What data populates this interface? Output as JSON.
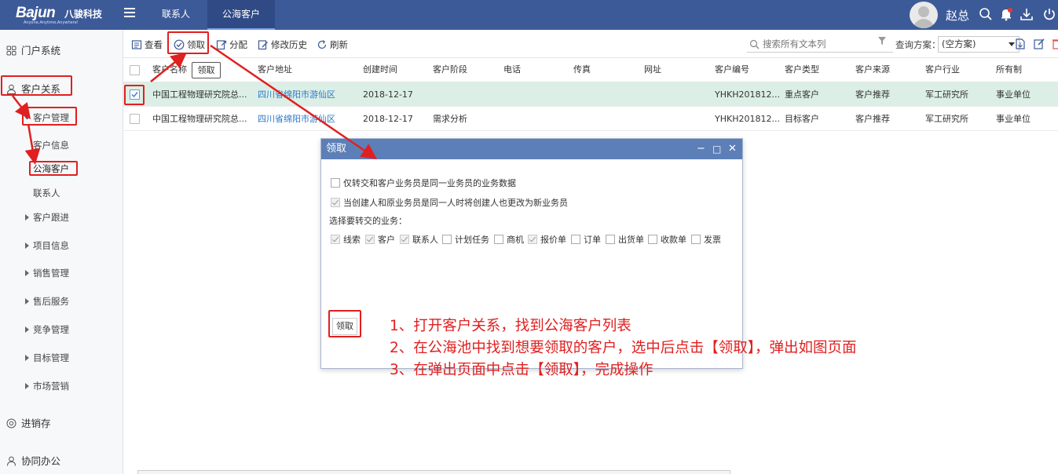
{
  "topbar": {
    "logo_brand": "Bajun",
    "logo_cn": "八骏科技",
    "logo_slogan": "Anyone,Anytime,Anywhere!",
    "tabs": [
      {
        "label": "联系人"
      },
      {
        "label": "公海客户"
      }
    ],
    "username": "赵总"
  },
  "sidebar": {
    "portal": "门户系统",
    "crm": "客户关系",
    "customer_mgmt": "客户管理",
    "customer_info": "客户信息",
    "public_customers": "公海客户",
    "contacts": "联系人",
    "groups": [
      "客户跟进",
      "项目信息",
      "销售管理",
      "售后服务",
      "竞争管理",
      "目标管理",
      "市场营销"
    ],
    "inventory": "进销存",
    "collab": "协同办公"
  },
  "toolbar": {
    "view": "查看",
    "claim": "领取",
    "assign": "分配",
    "history": "修改历史",
    "refresh": "刷新",
    "search_placeholder": "搜索所有文本列",
    "plan_label": "查询方案：",
    "plan_value": "(空方案)"
  },
  "grid": {
    "columns": [
      "客户名称",
      "客户地址",
      "创建时间",
      "客户阶段",
      "电话",
      "传真",
      "网址",
      "客户编号",
      "客户类型",
      "客户来源",
      "客户行业",
      "所有制"
    ],
    "claim_tooltip": "领取",
    "rows": [
      {
        "checked": true,
        "name": "中国工程物理研究院总...",
        "address": "四川省绵阳市游仙区",
        "created": "2018-12-17",
        "stage": "",
        "phone": "",
        "fax": "",
        "url": "",
        "code": "YHKH201812...",
        "type": "重点客户",
        "source": "客户推荐",
        "industry": "军工研究所",
        "ownership": "事业单位"
      },
      {
        "checked": false,
        "name": "中国工程物理研究院总...",
        "address": "四川省绵阳市游仙区",
        "created": "2018-12-17",
        "stage": "需求分析",
        "phone": "",
        "fax": "",
        "url": "",
        "code": "YHKH201812...",
        "type": "目标客户",
        "source": "客户推荐",
        "industry": "军工研究所",
        "ownership": "事业单位"
      }
    ]
  },
  "dialog": {
    "title": "领取",
    "opt1": "仅转交和客户业务员是同一业务员的业务数据",
    "opt2": "当创建人和原业务员是同一人时将创建人也更改为新业务员",
    "select_label": "选择要转交的业务：",
    "biz": [
      {
        "label": "线索",
        "checked": true
      },
      {
        "label": "客户",
        "checked": true
      },
      {
        "label": "联系人",
        "checked": true
      },
      {
        "label": "计划任务",
        "checked": false
      },
      {
        "label": "商机",
        "checked": false
      },
      {
        "label": "报价单",
        "checked": true
      },
      {
        "label": "订单",
        "checked": false
      },
      {
        "label": "出货单",
        "checked": false
      },
      {
        "label": "收款单",
        "checked": false
      },
      {
        "label": "发票",
        "checked": false
      }
    ],
    "button": "领取"
  },
  "instructions": [
    "1、打开客户关系，找到公海客户列表",
    "2、在公海池中找到想要领取的客户，选中后点击【领取】，弹出如图页面",
    "3、在弹出页面中点击【领取】，完成操作"
  ],
  "colors": {
    "topbar": "#3d5a98",
    "annotation": "#e02020",
    "selected_row": "#dcefe6",
    "dialog_title": "#5d7fb8",
    "link": "#2a78c8"
  }
}
